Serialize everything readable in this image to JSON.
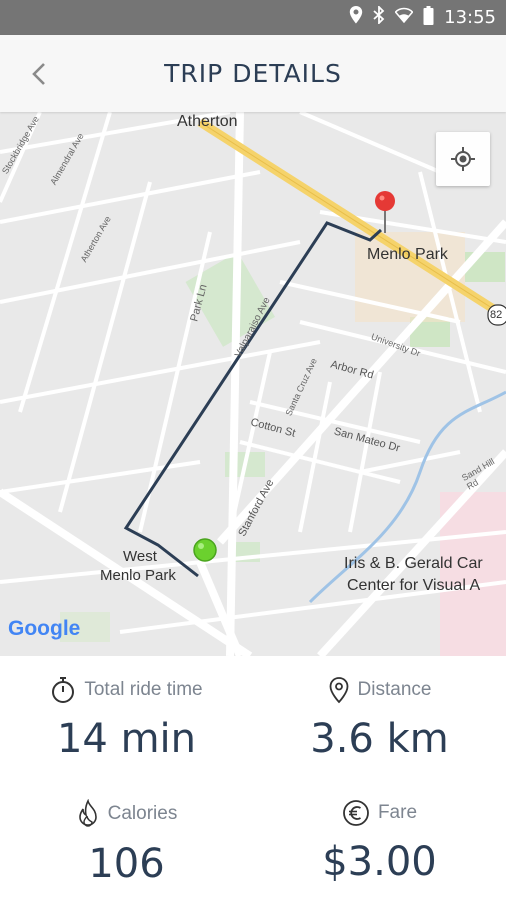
{
  "status_bar": {
    "time": "13:55",
    "icons": [
      "location-icon",
      "bluetooth-icon",
      "wifi-icon",
      "battery-icon"
    ]
  },
  "header": {
    "title": "TRIP DETAILS",
    "back_icon": "chevron-left-icon"
  },
  "map": {
    "labels": {
      "atherton": "Atherton",
      "menlo_park": "Menlo Park",
      "west_menlo_1": "West",
      "west_menlo_2": "Menlo Park",
      "park_ln": "Park Ln",
      "valparaiso": "Valparaiso Ave",
      "cotton": "Cotton St",
      "arbor": "Arbor Rd",
      "santa_cruz": "Santa Cruz Ave",
      "san_mateo": "San Mateo Dr",
      "stanford": "Stanford Ave",
      "university": "University Dr",
      "stockbridge": "Stockbridge Ave",
      "atherton_ave": "Atherton Ave",
      "almendral": "Almendral Ave",
      "sand_hill": "Sand Hill Rd",
      "iris_1": "Iris & B. Gerald Car",
      "iris_2": "Center for Visual A",
      "shield": "82",
      "google": "Google"
    }
  },
  "stats": {
    "ride_time": {
      "label": "Total ride time",
      "value": "14 min",
      "icon": "stopwatch-icon"
    },
    "distance": {
      "label": "Distance",
      "value": "3.6 km",
      "icon": "map-pin-icon"
    },
    "calories": {
      "label": "Calories",
      "value": "106",
      "icon": "flame-icon"
    },
    "fare": {
      "label": "Fare",
      "value": "$3.00",
      "icon": "euro-icon"
    }
  },
  "colors": {
    "route": "#2c3e55",
    "start": "#6bd12e",
    "end": "#e53935",
    "highway": "#f5d36b"
  }
}
